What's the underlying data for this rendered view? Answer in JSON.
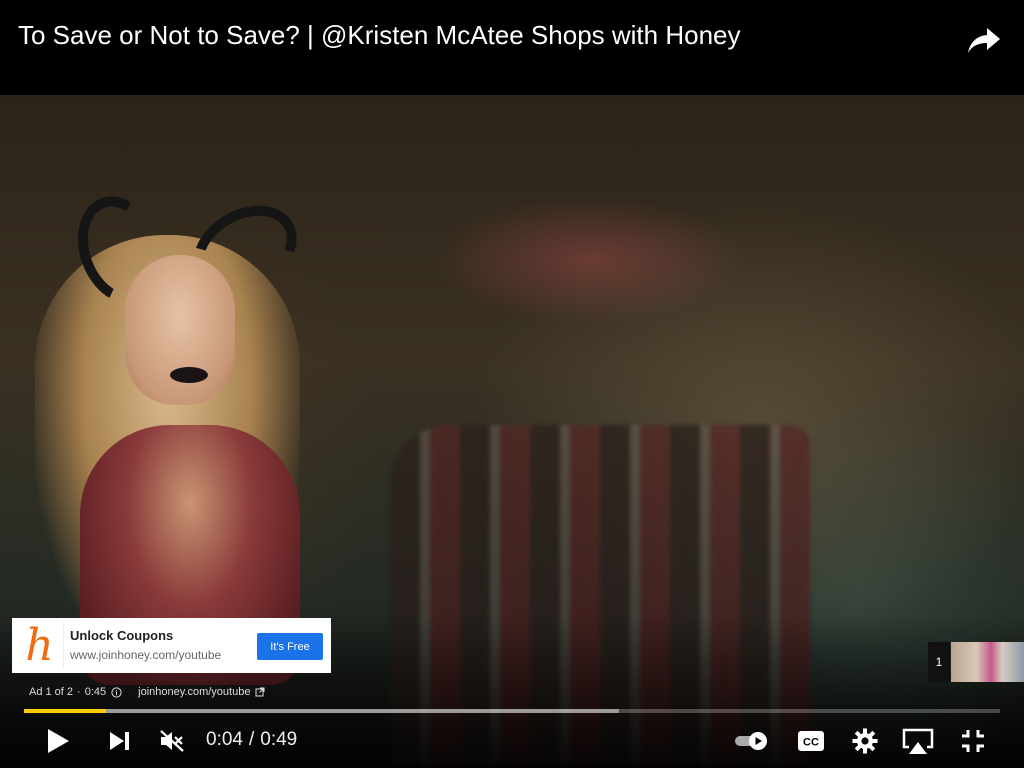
{
  "video": {
    "title": "To Save or Not to Save? | @Kristen McAtee Shops with Honey",
    "progress_fraction": 0.084,
    "buffered_fraction": 0.61
  },
  "ad_card": {
    "logo_letter": "h",
    "headline": "Unlock Coupons",
    "url": "www.joinhoney.com/youtube",
    "cta": "It's Free",
    "brand_color": "#f26c0d",
    "cta_color": "#1a73e8"
  },
  "ad_info": {
    "position": "Ad 1 of 2",
    "separator": "·",
    "remaining": "0:45",
    "domain": "joinhoney.com/youtube"
  },
  "up_next": {
    "count": "1"
  },
  "controls": {
    "current_time": "0:04",
    "separator": "/",
    "duration": "0:49",
    "progress_color": "#ffcc00",
    "icons": [
      "play-icon",
      "next-icon",
      "mute-icon",
      "autoplay-toggle-icon",
      "captions-icon",
      "settings-icon",
      "airplay-icon",
      "exit-fullscreen-icon"
    ]
  }
}
